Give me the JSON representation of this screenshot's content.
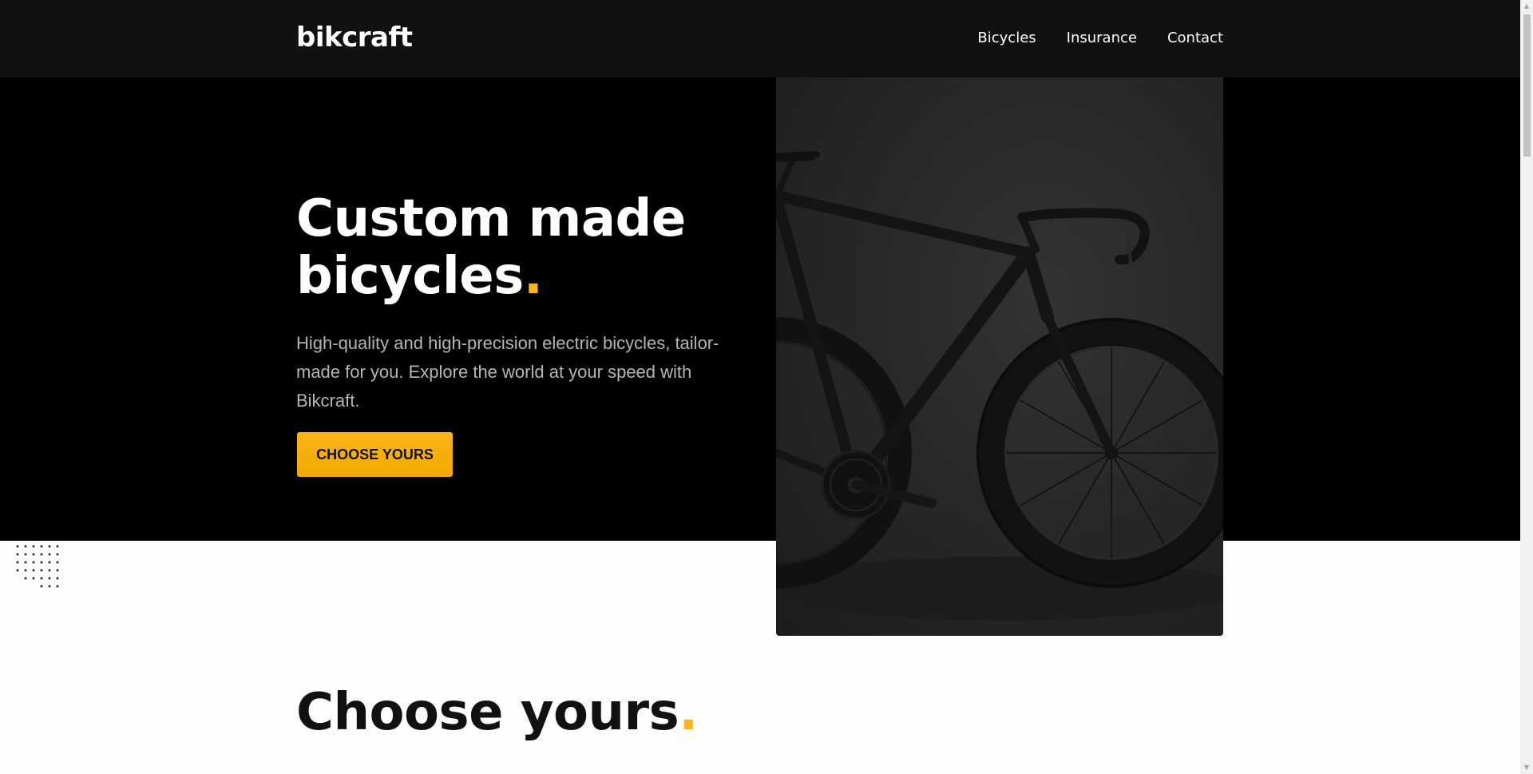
{
  "header": {
    "logo": "bikcraft",
    "nav": [
      {
        "label": "Bicycles"
      },
      {
        "label": "Insurance"
      },
      {
        "label": "Contact"
      }
    ]
  },
  "hero": {
    "title_line1": "Custom made",
    "title_line2": "bicycles",
    "title_dot": ".",
    "text": "High-quality and high-precision electric bicycles, tailor-made for you. Explore the world at your speed with Bikcraft.",
    "cta_label": "CHOOSE YOURS",
    "image_alt": "Black road bicycle"
  },
  "section": {
    "title": "Choose yours",
    "title_dot": "."
  },
  "colors": {
    "accent": "#fbb419",
    "header_bg": "#111111",
    "hero_bg": "#000000"
  }
}
